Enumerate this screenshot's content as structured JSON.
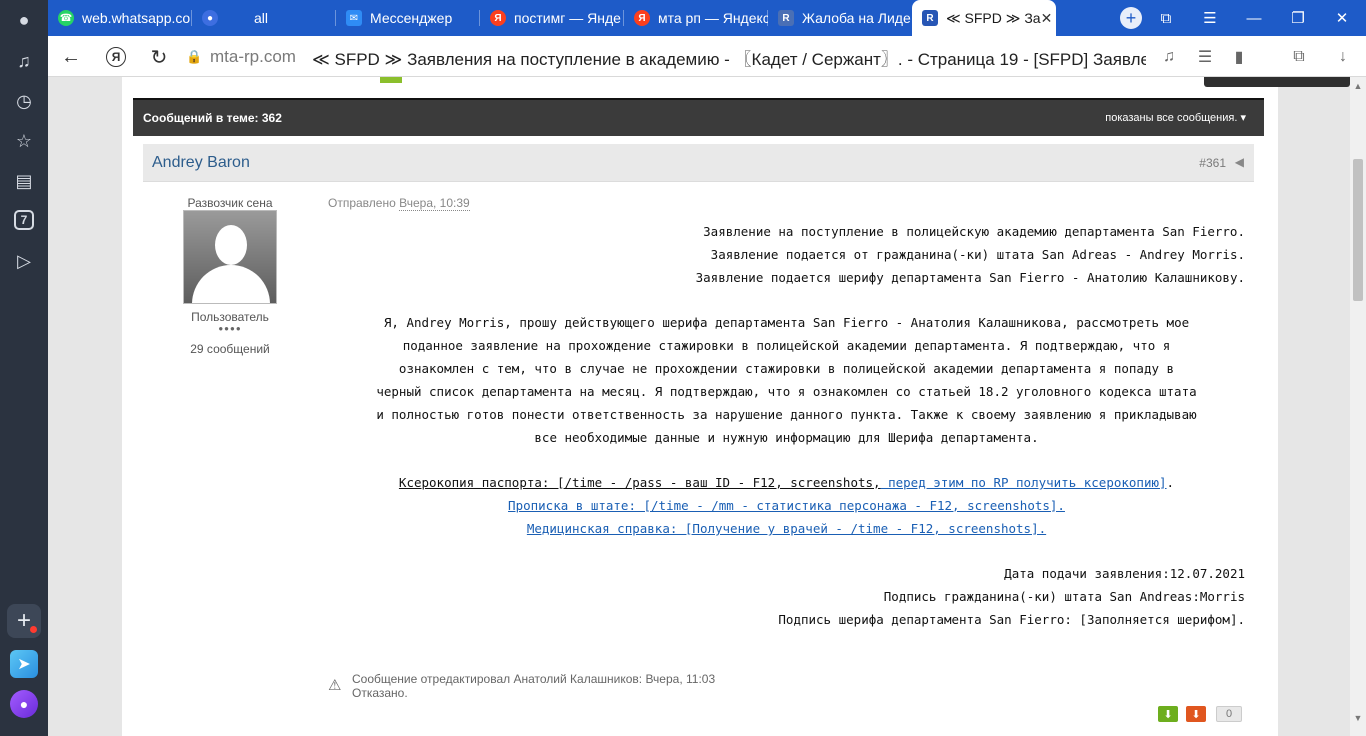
{
  "browser": {
    "tabs": [
      {
        "title": "web.whatsapp.co",
        "favicon": "whatsapp-icon",
        "color": "#25d366"
      },
      {
        "title": "all",
        "favicon": "record-icon",
        "color": "#3d6ee0"
      },
      {
        "title": "Мессенджер",
        "favicon": "messenger-icon",
        "color": "#2f8cf5"
      },
      {
        "title": "постимг — Янде",
        "favicon": "yandex-icon",
        "color": "#fc3f1d"
      },
      {
        "title": "мта рп — Яндекс",
        "favicon": "yandex-icon",
        "color": "#fc3f1d"
      },
      {
        "title": "Жалоба на Лиде",
        "favicon": "forum-icon",
        "color": "#4a6fb5"
      },
      {
        "title": "≪ SFPD ≫ За",
        "favicon": "forum-icon",
        "color": "#2756b5",
        "active": true
      }
    ],
    "address": {
      "domain": "mta-rp.com",
      "title": "≪ SFPD ≫ Заявления на поступление в академию - 〖Кадет / Сержант〗. - Страница 19 - [SFPD] Заявлени..."
    },
    "sidebar_badge": "7"
  },
  "thread": {
    "messages_count_label": "Сообщений в теме: 362",
    "filter_label": "показаны все сообщения."
  },
  "post": {
    "author": "Andrey Baron",
    "number": "#361",
    "rank": "Развозчик сена",
    "role": "Пользователь",
    "dots": "●●●●",
    "message_count": "29 сообщений",
    "sent_label": "Отправлено",
    "sent_time": "Вчера, 10:39",
    "header_lines": [
      "Заявление на поступление в полицейскую академию департамента San Fierro.",
      "Заявление подается от гражданина(-ки) штата San Adreas - Andrey Morris.",
      "Заявление подается шерифу департамента San Fierro - Анатолию Калашникову."
    ],
    "paragraph_lines": [
      "Я, Andrey Morris, прошу действующего шерифа департамента San Fierro - Анатолия Калашникова, рассмотреть мое",
      "поданное заявление на прохождение стажировки в полицейской академии департамента.  Я подтверждаю, что я",
      "ознакомлен с тем, что в случае не прохождении стажировки в полицейской академии департамента я попаду в",
      "черный список департамента на месяц. Я подтверждаю, что я ознакомлен со статьей 18.2 уголовного кодекса штата",
      "и полностью готов понести ответственность за нарушение данного пункта. Также к своему заявлению я прикладываю",
      "все необходимые данные и нужную информацию для Шерифа департамента."
    ],
    "passport_text": "Ксерокопия паспорта: [/time - /pass - ваш ID - F12, screenshots,",
    "passport_link": " перед этим по RP получить ксерокопию]",
    "passport_end": ".",
    "registration_link": "Прописка в штате: [/time - /mm - статистика персонажа - F12, screenshots].",
    "medical_link": "Медицинская справка: [Получение у врачей - /time - F12, screenshots].",
    "date_line": "Дата подачи заявления:12.07.2021",
    "citizen_sign": "Подпись гражданина(-ки) штата San Andreas:Morris",
    "sheriff_sign": "Подпись шерифа департамента San Fierro: [Заполняется шерифом].",
    "edit_note": "Сообщение отредактировал Анатолий Калашников: Вчера, 11:03",
    "edit_status": "Отказано.",
    "rating": "0"
  },
  "colors": {
    "tab_strip": "#1e5bc8",
    "author": "#2d5d8c",
    "link": "#1a5fb4",
    "upvote": "#6dae1e",
    "downvote": "#e0561f"
  }
}
